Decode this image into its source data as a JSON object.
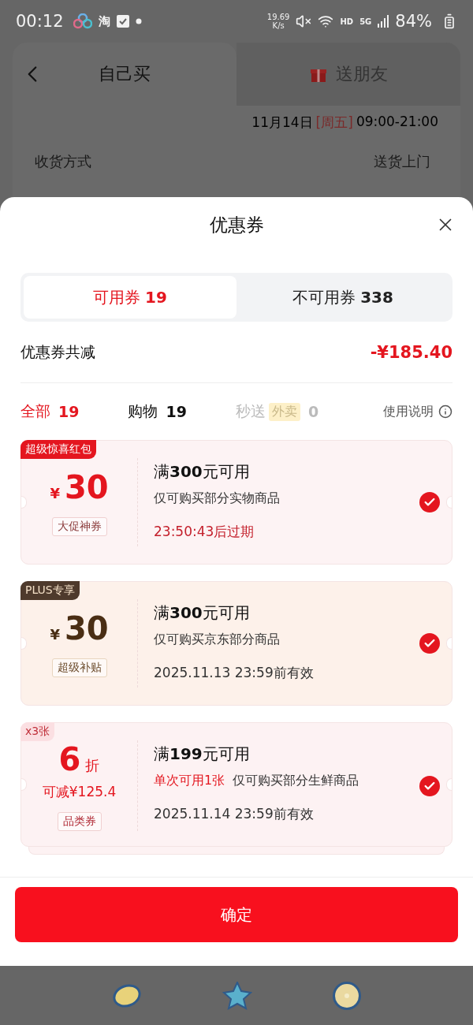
{
  "status_bar": {
    "time": "00:12",
    "app_glyph": "淘",
    "speed_value": "19.69",
    "speed_unit": "K/s",
    "hd": "HD",
    "network": "5G",
    "battery": "84%"
  },
  "background": {
    "tabs": [
      {
        "label": "自己买",
        "selected": true
      },
      {
        "label": "送朋友",
        "selected": false
      }
    ],
    "delivery_time": {
      "date": "11月14日",
      "weekday": "[周五]",
      "hours": "09:00-21:00"
    },
    "delivery_row": {
      "label": "收货方式",
      "value": "送货上门"
    }
  },
  "sheet": {
    "title": "优惠券",
    "tabs": [
      {
        "label": "可用券",
        "count": "19",
        "selected": true
      },
      {
        "label": "不可用券",
        "count": "338",
        "selected": false
      }
    ],
    "total": {
      "label": "优惠券共减",
      "value": "-¥185.40"
    },
    "filters": [
      {
        "label": "全部",
        "count": "19",
        "selected": true,
        "disabled": false
      },
      {
        "label": "购物",
        "count": "19",
        "selected": false,
        "disabled": false
      },
      {
        "label": "秒送",
        "tag": "外卖",
        "count": "0",
        "selected": false,
        "disabled": true
      }
    ],
    "help": "使用说明",
    "coupons": [
      {
        "kind": "cash",
        "color": "#e4161f",
        "badge": "超级惊喜红包",
        "currency": "¥",
        "amount": "30",
        "label": "大促神券",
        "threshold": "满**300**元可用",
        "restriction": "仅可购买部分实物商品",
        "expiry": "23:50:43后过期",
        "expiry_urgent": true,
        "checked": true,
        "stacked": false
      },
      {
        "kind": "cash",
        "color": "#4e3a2c",
        "badge": "PLUS专享",
        "currency": "¥",
        "amount": "30",
        "label": "超级补贴",
        "threshold": "满**300**元可用",
        "restriction": "仅可购买京东部分商品",
        "expiry": "2025.11.13 23:59前有效",
        "expiry_urgent": false,
        "checked": true,
        "stacked": false
      },
      {
        "kind": "discount",
        "color": "#fbdfe2",
        "badge": "x3张",
        "amount": "6",
        "unit": "折",
        "saving": "可减¥125.4",
        "label": "品类券",
        "threshold": "满**199**元可用",
        "limit": "单次可用1张",
        "restriction": "仅可购买部分生鲜商品",
        "expiry": "2025.11.14 23:59前有效",
        "expiry_urgent": false,
        "checked": true,
        "stacked": true
      }
    ],
    "confirm": "确定"
  }
}
